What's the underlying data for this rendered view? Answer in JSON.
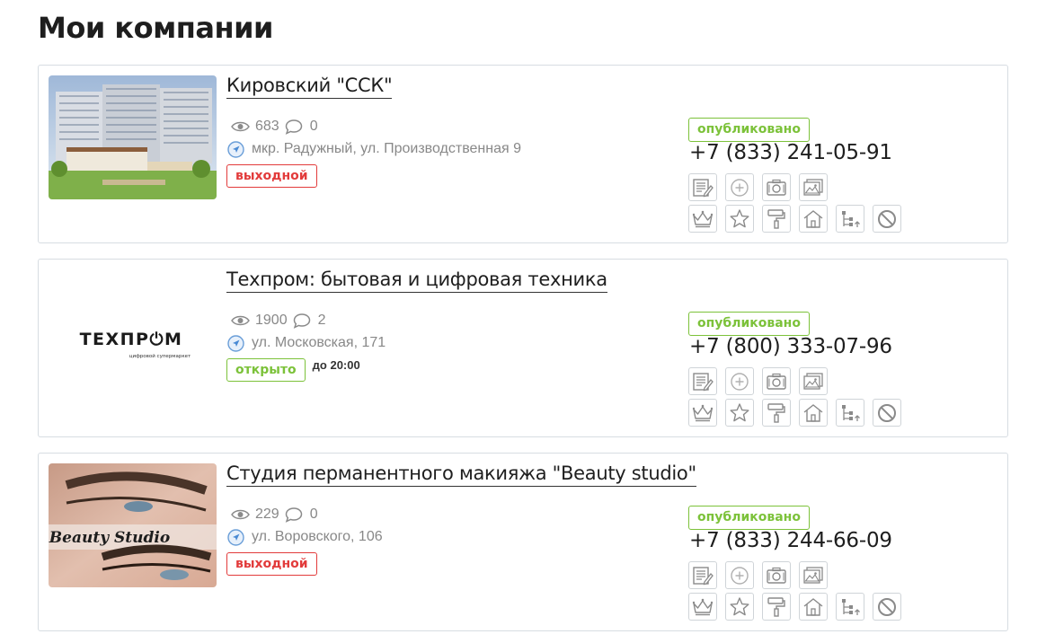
{
  "page": {
    "title": "Мои компании"
  },
  "companies": [
    {
      "name": "Кировский \"ССК\"",
      "views": "683",
      "comments": "0",
      "address": "мкр. Радужный, ул. Производственная 9",
      "hours_badge": "выходной",
      "hours_state": "closed",
      "hours_until": "",
      "status": "опубликовано",
      "phone": "+7 (833) 241-05-91",
      "thumb": "building-photo"
    },
    {
      "name": "Техпром: бытовая и цифровая техника",
      "views": "1900",
      "comments": "2",
      "address": "ул. Московская, 171",
      "hours_badge": "открыто",
      "hours_state": "open",
      "hours_until": "до 20:00",
      "status": "опубликовано",
      "phone": "+7 (800) 333-07-96",
      "thumb": "logo",
      "logo_text": "ТЕХПР⏻М",
      "logo_sub": "цифровой супермаркет"
    },
    {
      "name": "Студия перманентного макияжа \"Beauty studio\"",
      "views": "229",
      "comments": "0",
      "address": "ул. Воровского, 106",
      "hours_badge": "выходной",
      "hours_state": "closed",
      "hours_until": "",
      "status": "опубликовано",
      "phone": "+7 (833) 244-66-09",
      "thumb": "eye-photo",
      "thumb_caption": "Beauty Studio"
    }
  ],
  "actions_row1": [
    "edit-icon",
    "plus-circle-icon",
    "camera-icon",
    "gallery-icon"
  ],
  "actions_row2": [
    "crown-icon",
    "star-icon",
    "paint-roller-icon",
    "home-icon",
    "tree-structure-icon",
    "ban-icon"
  ],
  "colors": {
    "open": "#7cc23a",
    "closed": "#e23b3b",
    "border": "#d7dde2",
    "icon": "#8a8a8a"
  }
}
